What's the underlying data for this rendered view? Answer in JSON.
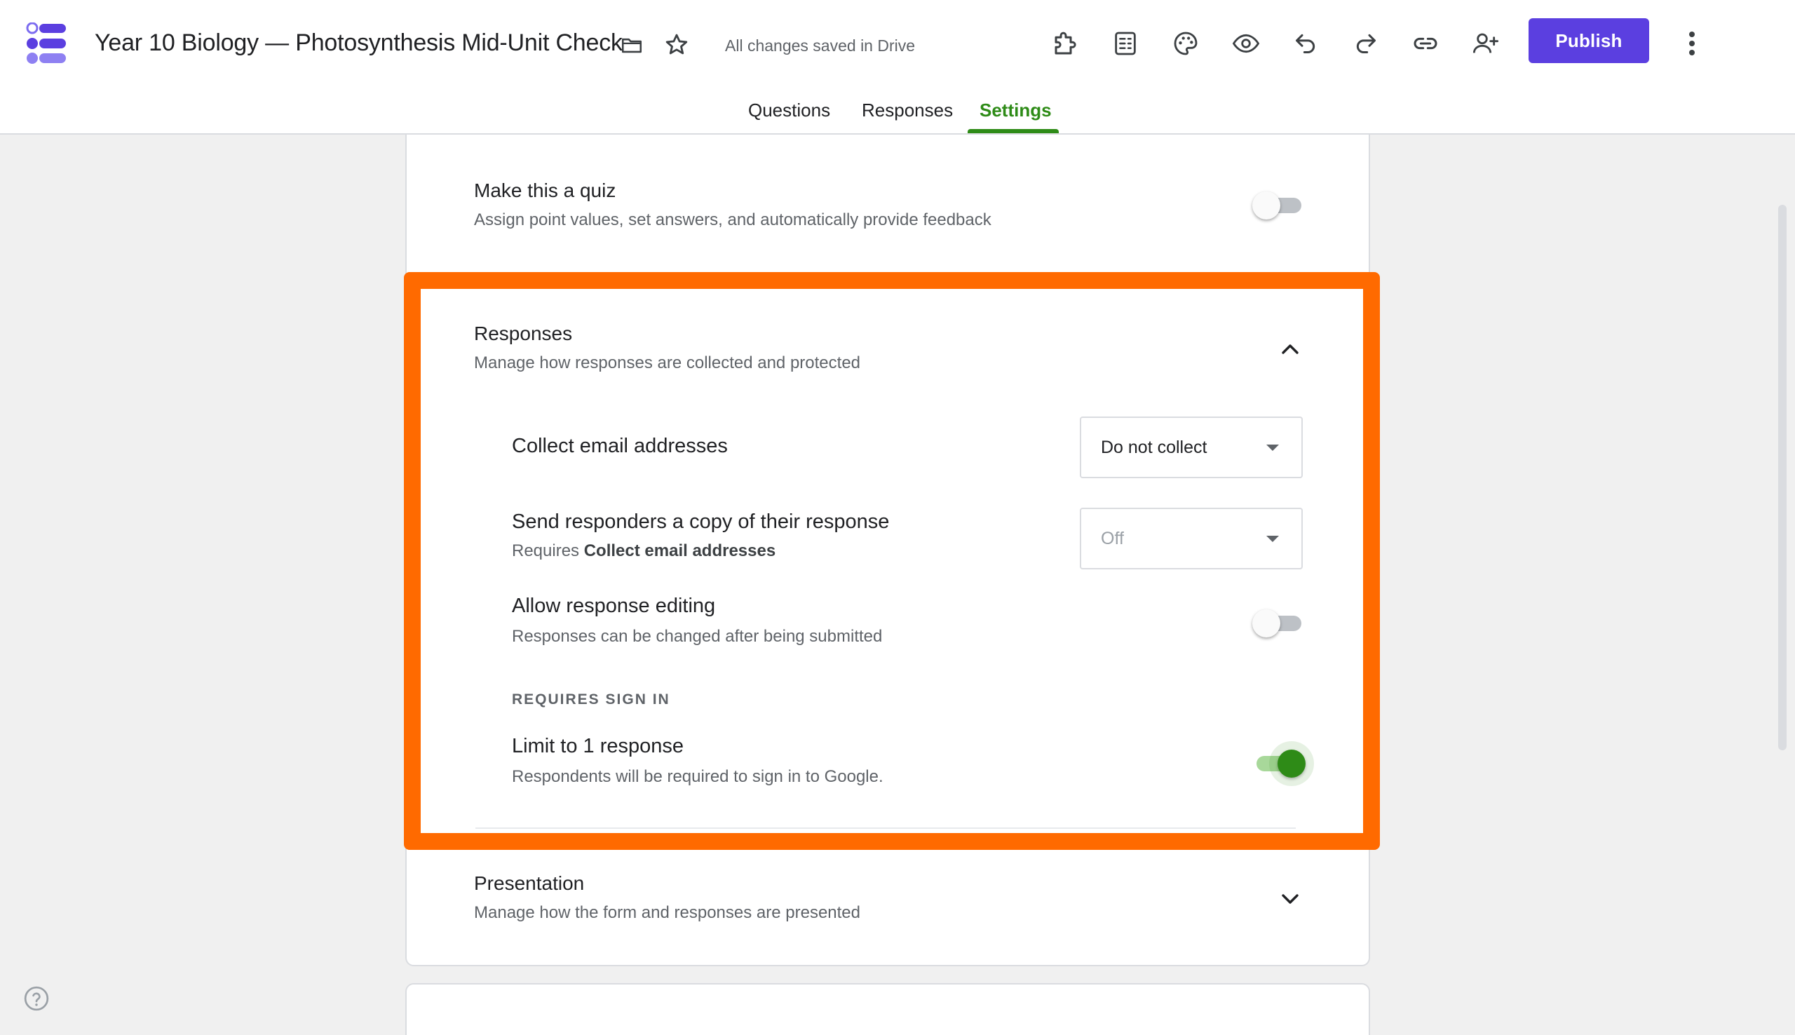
{
  "header": {
    "title": "Year 10 Biology — Photosynthesis Mid-Unit Check",
    "save_status": "All changes saved in Drive",
    "publish_label": "Publish"
  },
  "tabs": [
    {
      "label": "Questions"
    },
    {
      "label": "Responses"
    },
    {
      "label": "Settings"
    }
  ],
  "settings": {
    "quiz": {
      "title": "Make this a quiz",
      "subtitle": "Assign point values, set answers, and automatically provide feedback",
      "enabled": false
    },
    "responses": {
      "title": "Responses",
      "subtitle": "Manage how responses are collected and protected",
      "expanded": true,
      "collect_email": {
        "title": "Collect email addresses",
        "value": "Do not collect"
      },
      "send_copy": {
        "title": "Send responders a copy of their response",
        "subtitle_prefix": "Requires ",
        "subtitle_bold": "Collect email addresses",
        "value": "Off"
      },
      "allow_editing": {
        "title": "Allow response editing",
        "subtitle": "Responses can be changed after being submitted",
        "enabled": false
      },
      "requires_sign_in_label": "REQUIRES SIGN IN",
      "limit_one": {
        "title": "Limit to 1 response",
        "subtitle": "Respondents will be required to sign in to Google.",
        "enabled": true
      }
    },
    "presentation": {
      "title": "Presentation",
      "subtitle": "Manage how the form and responses are presented",
      "expanded": false
    }
  },
  "colors": {
    "brand": "#5b3fe0",
    "accent_green": "#2e8b17",
    "highlight": "#ff6a00"
  }
}
